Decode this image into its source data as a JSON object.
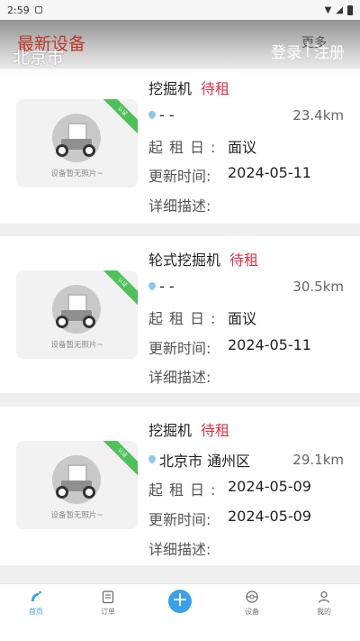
{
  "status_bar": {
    "time": "2:59"
  },
  "header": {
    "section_title": "最新设备",
    "more": "更多",
    "city": "北京市",
    "login": "登录",
    "separator": "|",
    "register": "注册"
  },
  "labels": {
    "start_date": "起租日:",
    "update_time": "更新时间:",
    "description": "详细描述:",
    "no_photo": "设备暂无照片~",
    "ribbon": "认证"
  },
  "listings": [
    {
      "name": "挖掘机",
      "status": "待租",
      "location": "- -",
      "distance": "23.4km",
      "start_date": "面议",
      "update_time": "2024-05-11",
      "description": ""
    },
    {
      "name": "轮式挖掘机",
      "status": "待租",
      "location": "- -",
      "distance": "30.5km",
      "start_date": "面议",
      "update_time": "2024-05-11",
      "description": ""
    },
    {
      "name": "挖掘机",
      "status": "待租",
      "location": "北京市 通州区",
      "distance": "29.1km",
      "start_date": "2024-05-09",
      "update_time": "2024-05-09",
      "description": ""
    }
  ],
  "tabs": [
    {
      "label": "首页",
      "icon": "home-icon",
      "active": true
    },
    {
      "label": "订单",
      "icon": "order-icon"
    },
    {
      "label": "",
      "icon": "plus-icon"
    },
    {
      "label": "设备",
      "icon": "equipment-icon"
    },
    {
      "label": "我的",
      "icon": "user-icon"
    }
  ],
  "colors": {
    "accent": "#3aa0e8",
    "status": "#e0334a",
    "title": "#c0392b",
    "ribbon": "#4fc05a"
  }
}
